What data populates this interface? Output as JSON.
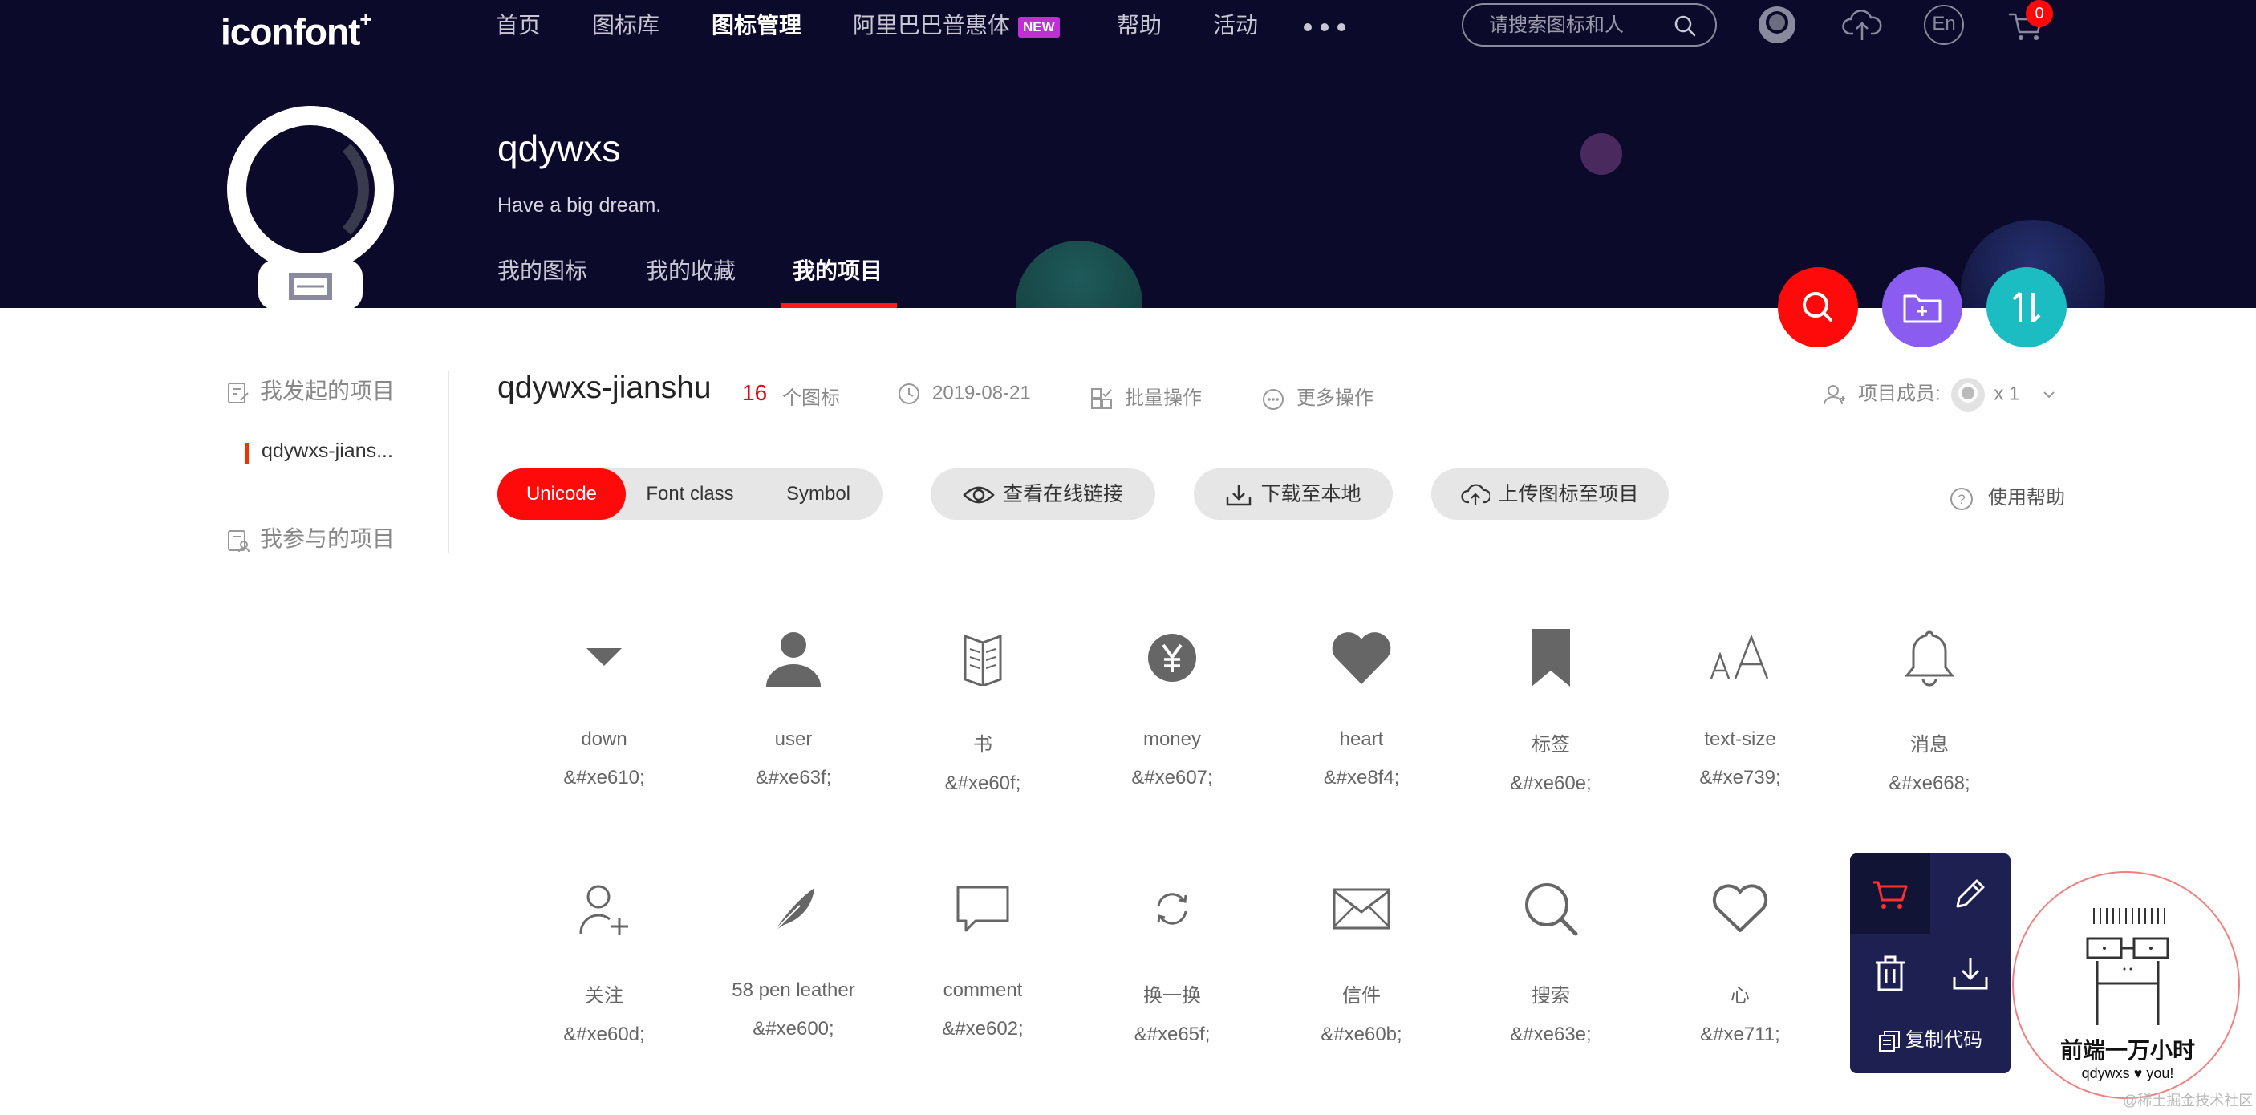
{
  "header": {
    "logo": "iconfont",
    "logo_plus": "+",
    "nav": [
      "首页",
      "图标库",
      "图标管理",
      "阿里巴巴普惠体",
      "帮助",
      "活动"
    ],
    "new_badge": "NEW",
    "search_placeholder": "请搜索图标和人",
    "lang": "En",
    "cart_count": "0"
  },
  "profile": {
    "username": "qdywxs",
    "motto": "Have a big dream.",
    "tabs": [
      "我的图标",
      "我的收藏",
      "我的项目"
    ],
    "active_tab": "我的项目"
  },
  "sidebar": {
    "started_heading": "我发起的项目",
    "project_item": "qdywxs-jians...",
    "joined_heading": "我参与的项目"
  },
  "project": {
    "title": "qdywxs-jianshu",
    "icon_count": "16",
    "icon_count_label": "个图标",
    "date": "2019-08-21",
    "batch_label": "批量操作",
    "more_label": "更多操作",
    "members_label": "项目成员:",
    "members_count": "x 1"
  },
  "toolbar": {
    "segments": [
      "Unicode",
      "Font class",
      "Symbol"
    ],
    "active_segment": "Unicode",
    "view_link": "查看在线链接",
    "download": "下载至本地",
    "upload": "上传图标至项目",
    "help": "使用帮助"
  },
  "icons": [
    {
      "name": "down",
      "code": "&#xe610;",
      "icon": "caret-down-icon"
    },
    {
      "name": "user",
      "code": "&#xe63f;",
      "icon": "user-icon"
    },
    {
      "name": "书",
      "code": "&#xe60f;",
      "icon": "book-icon"
    },
    {
      "name": "money",
      "code": "&#xe607;",
      "icon": "yen-icon"
    },
    {
      "name": "heart",
      "code": "&#xe8f4;",
      "icon": "heart-filled-icon"
    },
    {
      "name": "标签",
      "code": "&#xe60e;",
      "icon": "bookmark-icon"
    },
    {
      "name": "text-size",
      "code": "&#xe739;",
      "icon": "text-size-icon"
    },
    {
      "name": "消息",
      "code": "&#xe668;",
      "icon": "bell-icon"
    },
    {
      "name": "关注",
      "code": "&#xe60d;",
      "icon": "user-add-icon"
    },
    {
      "name": "58 pen leather",
      "code": "&#xe600;",
      "icon": "feather-icon"
    },
    {
      "name": "comment",
      "code": "&#xe602;",
      "icon": "comment-icon"
    },
    {
      "name": "换一换",
      "code": "&#xe65f;",
      "icon": "refresh-icon"
    },
    {
      "name": "信件",
      "code": "&#xe60b;",
      "icon": "mail-icon"
    },
    {
      "name": "搜索",
      "code": "&#xe63e;",
      "icon": "search-icon"
    },
    {
      "name": "心",
      "code": "&#xe711;",
      "icon": "heart-outline-icon"
    }
  ],
  "hover_panel": {
    "copy_code": "复制代码"
  },
  "watermark": {
    "title": "前端一万小时",
    "subtitle": "qdywxs ♥ you!",
    "footer": "@稀土掘金技术社区"
  },
  "colors": {
    "banner_bg": "#0c0a2a",
    "accent_red": "#ff0a0a",
    "fab_purple": "#8a5cf0",
    "fab_teal": "#1bbcc2",
    "panel_bg": "#1d2050"
  }
}
